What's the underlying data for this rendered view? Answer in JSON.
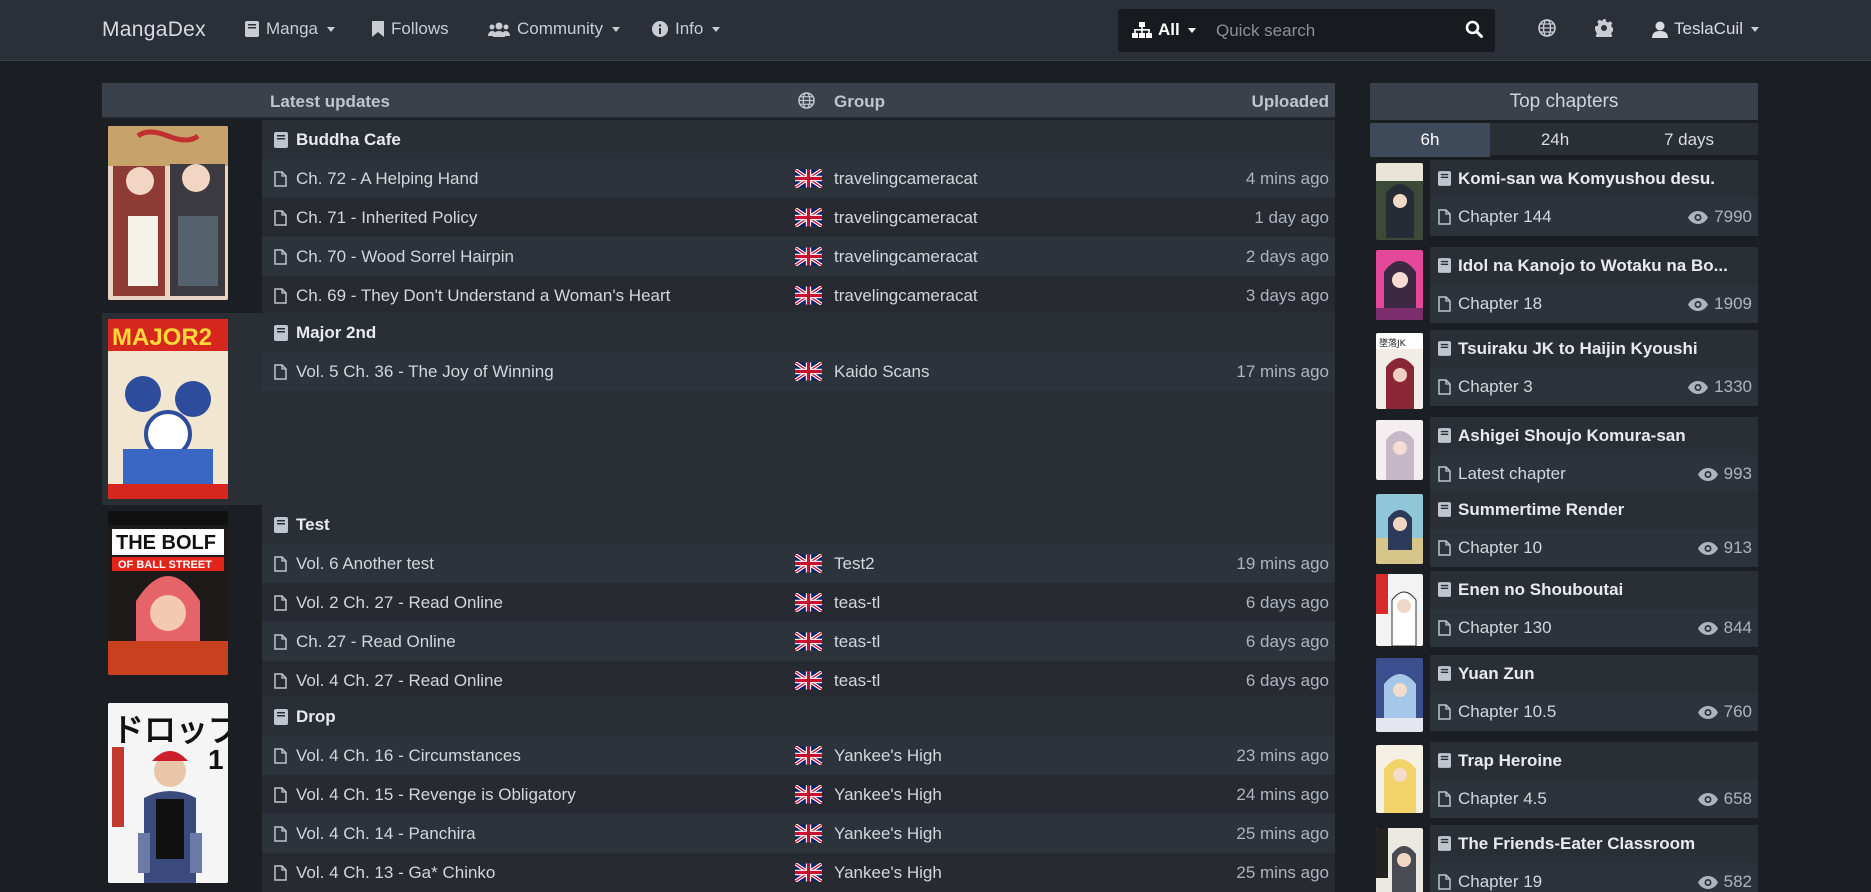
{
  "navbar": {
    "brand": "MangaDex",
    "items": [
      {
        "label": "Manga",
        "icon": "book-icon",
        "dropdown": true
      },
      {
        "label": "Follows",
        "icon": "bookmark-icon",
        "dropdown": false
      },
      {
        "label": "Community",
        "icon": "users-icon",
        "dropdown": true
      },
      {
        "label": "Info",
        "icon": "info-icon",
        "dropdown": true
      }
    ],
    "search": {
      "scope": "All",
      "placeholder": "Quick search"
    },
    "user": "TeslaCuil"
  },
  "latest": {
    "headers": {
      "title": "Latest updates",
      "group": "Group",
      "uploaded": "Uploaded"
    },
    "manga": [
      {
        "title": "Buddha Cafe",
        "chapters": [
          {
            "name": "Ch. 72 - A Helping Hand",
            "group": "travelingcameracat",
            "time": "4 mins ago"
          },
          {
            "name": "Ch. 71 - Inherited Policy",
            "group": "travelingcameracat",
            "time": "1 day ago"
          },
          {
            "name": "Ch. 70 - Wood Sorrel Hairpin",
            "group": "travelingcameracat",
            "time": "2 days ago"
          },
          {
            "name": "Ch. 69 - They Don't Understand a Woman's Heart",
            "group": "travelingcameracat",
            "time": "3 days ago"
          }
        ]
      },
      {
        "title": "Major 2nd",
        "chapters": [
          {
            "name": "Vol. 5 Ch. 36 - The Joy of Winning",
            "group": "Kaido Scans",
            "time": "17 mins ago"
          }
        ]
      },
      {
        "title": "Test",
        "chapters": [
          {
            "name": "Vol. 6 Another test",
            "group": "Test2",
            "time": "19 mins ago"
          },
          {
            "name": "Vol. 2 Ch. 27 - Read Online",
            "group": "teas-tl",
            "time": "6 days ago"
          },
          {
            "name": "Ch. 27 - Read Online",
            "group": "teas-tl",
            "time": "6 days ago"
          },
          {
            "name": "Vol. 4 Ch. 27 - Read Online",
            "group": "teas-tl",
            "time": "6 days ago"
          }
        ]
      },
      {
        "title": "Drop",
        "chapters": [
          {
            "name": "Vol. 4 Ch. 16 - Circumstances",
            "group": "Yankee's High",
            "time": "23 mins ago"
          },
          {
            "name": "Vol. 4 Ch. 15 - Revenge is Obligatory",
            "group": "Yankee's High",
            "time": "24 mins ago"
          },
          {
            "name": "Vol. 4 Ch. 14 - Panchira",
            "group": "Yankee's High",
            "time": "25 mins ago"
          },
          {
            "name": "Vol. 4 Ch. 13 - Ga* Chinko",
            "group": "Yankee's High",
            "time": "25 mins ago"
          }
        ]
      }
    ]
  },
  "top": {
    "title": "Top chapters",
    "tabs": [
      "6h",
      "24h",
      "7 days"
    ],
    "active_tab": "6h",
    "items": [
      {
        "title": "Komi-san wa Komyushou desu.",
        "chapter": "Chapter 144",
        "views": "7990"
      },
      {
        "title": "Idol na Kanojo to Wotaku na Bo...",
        "chapter": "Chapter 18",
        "views": "1909"
      },
      {
        "title": "Tsuiraku JK to Haijin Kyoushi",
        "chapter": "Chapter 3",
        "views": "1330"
      },
      {
        "title": "Ashigei Shoujo Komura-san",
        "chapter": "Latest chapter",
        "views": "993"
      },
      {
        "title": "Summertime Render",
        "chapter": "Chapter 10",
        "views": "913"
      },
      {
        "title": "Enen no Shouboutai",
        "chapter": "Chapter 130",
        "views": "844"
      },
      {
        "title": "Yuan Zun",
        "chapter": "Chapter 10.5",
        "views": "760"
      },
      {
        "title": "Trap Heroine",
        "chapter": "Chapter 4.5",
        "views": "658"
      },
      {
        "title": "The Friends-Eater Classroom",
        "chapter": "Chapter 19",
        "views": "582"
      }
    ]
  }
}
